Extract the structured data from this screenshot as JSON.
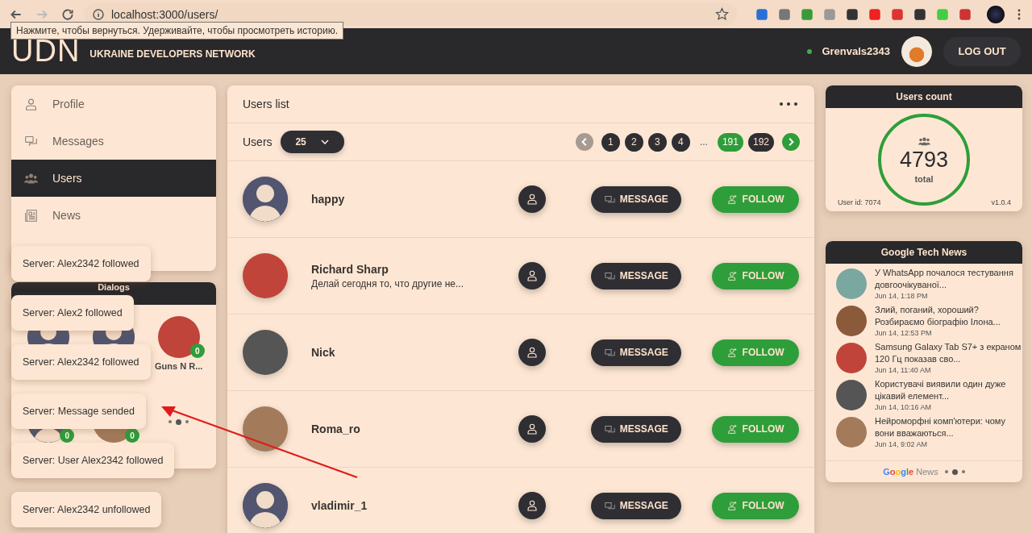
{
  "browser": {
    "url": "localhost:3000/users/",
    "tooltip": "Нажмите, чтобы вернуться. Удерживайте, чтобы просмотреть историю."
  },
  "header": {
    "logo": "UDN",
    "subtitle": "UKRAINE DEVELOPERS NETWORK",
    "username": "Grenvals2343",
    "online": true,
    "logout": "LOG OUT"
  },
  "sidebar": {
    "items": [
      {
        "label": "Profile",
        "kind": "person",
        "selected": false
      },
      {
        "label": "Messages",
        "kind": "chat",
        "selected": false
      },
      {
        "label": "Users",
        "kind": "group",
        "selected": true
      },
      {
        "label": "News",
        "kind": "news",
        "selected": false
      }
    ]
  },
  "dialogs": {
    "title": "Dialogs",
    "items": [
      {
        "kind": "silhouette"
      },
      {
        "kind": "silhouette"
      },
      {
        "kind": "photo",
        "name": "Guns N R...",
        "badge": "0"
      },
      {
        "kind": "silhouette",
        "badge": "0"
      },
      {
        "kind": "photo",
        "badge": "0"
      }
    ],
    "dots": [
      {
        "selected": false
      },
      {
        "selected": true
      },
      {
        "selected": false
      }
    ]
  },
  "toasts": [
    "Server: Alex2342 followed",
    "Server: Alex2 followed",
    "Server: Alex2342 followed",
    "Server: Message sended",
    "Server: User Alex2342 followed",
    "Server: Alex2342 unfollowed"
  ],
  "users_list": {
    "title": "Users list",
    "page_size_label": "Users",
    "page_size": "25",
    "pagination": {
      "prev_disabled": true,
      "next_disabled": false,
      "pages": [
        {
          "label": "1",
          "kind": "page",
          "selected": false
        },
        {
          "label": "2",
          "kind": "page",
          "selected": false
        },
        {
          "label": "3",
          "kind": "page",
          "selected": false
        },
        {
          "label": "4",
          "kind": "page",
          "selected": false
        },
        {
          "label": "...",
          "kind": "gap",
          "selected": false
        },
        {
          "label": "191",
          "kind": "page",
          "selected": true
        },
        {
          "label": "192",
          "kind": "page",
          "selected": false
        }
      ]
    },
    "rows": [
      {
        "name": "happy",
        "kind": "silhouette",
        "message": "MESSAGE",
        "follow": "FOLLOW"
      },
      {
        "name": "Richard Sharp",
        "status": "Делай сегодня то, что другие не...",
        "kind": "photo",
        "message": "MESSAGE",
        "follow": "FOLLOW"
      },
      {
        "name": "Nick",
        "kind": "photo",
        "message": "MESSAGE",
        "follow": "FOLLOW"
      },
      {
        "name": "Roma_ro",
        "kind": "photo",
        "message": "MESSAGE",
        "follow": "FOLLOW"
      },
      {
        "name": "vladimir_1",
        "kind": "silhouette",
        "message": "MESSAGE",
        "follow": "FOLLOW"
      }
    ]
  },
  "users_count": {
    "title": "Users count",
    "total": "4793",
    "total_label": "total",
    "user_id": "User id: 7074",
    "version": "v1.0.4"
  },
  "news": {
    "title": "Google Tech News",
    "items": [
      {
        "title": "У WhatsApp почалося тестування довгоочікуваної...",
        "date": "Jun 14, 1:18 PM"
      },
      {
        "title": "Злий, поганий, хороший? Розбираємо біографію Ілона...",
        "date": "Jun 14, 12:53 PM"
      },
      {
        "title": "Samsung Galaxy Tab S7+ з екраном 120 Гц показав сво...",
        "date": "Jun 14, 11:40 AM"
      },
      {
        "title": "Користувачі виявили один дуже цікавий елемент...",
        "date": "Jun 14, 10:16 AM"
      },
      {
        "title": "Нейроморфні комп'ютери: чому вони вважаються...",
        "date": "Jun 14, 9:02 AM"
      }
    ],
    "brand": "Google",
    "footer": "News",
    "dots": [
      {
        "selected": false
      },
      {
        "selected": true
      },
      {
        "selected": false
      }
    ]
  }
}
